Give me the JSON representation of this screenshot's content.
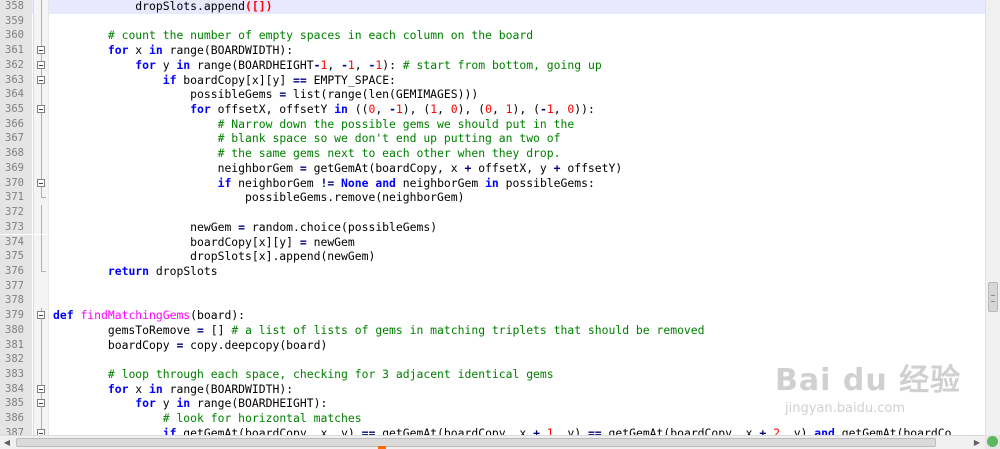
{
  "editor": {
    "lines": [
      {
        "n": "358",
        "fold": "line",
        "current": true,
        "html": "            dropSlots.append<span class=\"brk-hl\">([])</span>"
      },
      {
        "n": "359",
        "fold": "line",
        "html": ""
      },
      {
        "n": "360",
        "fold": "line",
        "html": "        <span class=\"cm\"># count the number of empty spaces in each column on the board</span>"
      },
      {
        "n": "361",
        "fold": "box",
        "html": "        <span class=\"kw\">for</span> x <span class=\"kw\">in</span> range(BOARDWIDTH):"
      },
      {
        "n": "362",
        "fold": "box",
        "html": "            <span class=\"kw\">for</span> y <span class=\"kw\">in</span> range(BOARDHEIGHT<span class=\"op\">-</span><span class=\"num\">1</span>, <span class=\"op\">-</span><span class=\"num\">1</span>, <span class=\"op\">-</span><span class=\"num\">1</span>): <span class=\"cm\"># start from bottom, going up</span>"
      },
      {
        "n": "363",
        "fold": "box",
        "html": "                <span class=\"kw\">if</span> boardCopy[x][y] <span class=\"op\">==</span> EMPTY_SPACE:"
      },
      {
        "n": "364",
        "fold": "line",
        "html": "                    possibleGems <span class=\"op\">=</span> list(range(len(GEMIMAGES)))"
      },
      {
        "n": "365",
        "fold": "box",
        "html": "                    <span class=\"kw\">for</span> offsetX, offsetY <span class=\"kw\">in</span> ((<span class=\"num\">0</span>, <span class=\"op\">-</span><span class=\"num\">1</span>), (<span class=\"num\">1</span>, <span class=\"num\">0</span>), (<span class=\"num\">0</span>, <span class=\"num\">1</span>), (<span class=\"op\">-</span><span class=\"num\">1</span>, <span class=\"num\">0</span>)):"
      },
      {
        "n": "366",
        "fold": "line",
        "html": "                        <span class=\"cm\"># Narrow down the possible gems we should put in the</span>"
      },
      {
        "n": "367",
        "fold": "line",
        "html": "                        <span class=\"cm\"># blank space so we don't end up putting an two of</span>"
      },
      {
        "n": "368",
        "fold": "line",
        "html": "                        <span class=\"cm\"># the same gems next to each other when they drop.</span>"
      },
      {
        "n": "369",
        "fold": "line",
        "html": "                        neighborGem <span class=\"op\">=</span> getGemAt(boardCopy, x <span class=\"op\">+</span> offsetX, y <span class=\"op\">+</span> offsetY)"
      },
      {
        "n": "370",
        "fold": "box",
        "html": "                        <span class=\"kw\">if</span> neighborGem <span class=\"op\">!=</span> <span class=\"kw\">None</span> <span class=\"kw\">and</span> neighborGem <span class=\"kw\">in</span> possibleGems:"
      },
      {
        "n": "371",
        "fold": "end",
        "html": "                            possibleGems.remove(neighborGem)"
      },
      {
        "n": "372",
        "fold": "line",
        "html": ""
      },
      {
        "n": "373",
        "fold": "line",
        "html": "                    newGem <span class=\"op\">=</span> random.choice(possibleGems)"
      },
      {
        "n": "374",
        "fold": "line",
        "html": "                    boardCopy[x][y] <span class=\"op\">=</span> newGem"
      },
      {
        "n": "375",
        "fold": "line",
        "html": "                    dropSlots[x].append(newGem)"
      },
      {
        "n": "376",
        "fold": "end",
        "html": "        <span class=\"kw\">return</span> dropSlots"
      },
      {
        "n": "377",
        "fold": "none",
        "html": ""
      },
      {
        "n": "378",
        "fold": "none",
        "html": ""
      },
      {
        "n": "379",
        "fold": "box",
        "html": "<span class=\"kw\">def</span> <span class=\"fn\">findMatchingGems</span>(board):"
      },
      {
        "n": "380",
        "fold": "line",
        "html": "        gemsToRemove <span class=\"op\">=</span> [] <span class=\"cm\"># a list of lists of gems in matching triplets that should be removed</span>"
      },
      {
        "n": "381",
        "fold": "line",
        "html": "        boardCopy <span class=\"op\">=</span> copy.deepcopy(board)"
      },
      {
        "n": "382",
        "fold": "line",
        "html": ""
      },
      {
        "n": "383",
        "fold": "line",
        "html": "        <span class=\"cm\"># loop through each space, checking for 3 adjacent identical gems</span>"
      },
      {
        "n": "384",
        "fold": "box",
        "html": "        <span class=\"kw\">for</span> x <span class=\"kw\">in</span> range(BOARDWIDTH):"
      },
      {
        "n": "385",
        "fold": "box",
        "html": "            <span class=\"kw\">for</span> y <span class=\"kw\">in</span> range(BOARDHEIGHT):"
      },
      {
        "n": "386",
        "fold": "line",
        "html": "                <span class=\"cm\"># look for horizontal matches</span>"
      },
      {
        "n": "387",
        "fold": "box",
        "html": "                <span class=\"kw\">if</span> getGemAt(boardCopy, x, y) <span class=\"op\">==</span> getGemAt(boardCopy, x <span class=\"op\">+</span> <span class=\"num\">1</span>, y) <span class=\"op\">==</span> getGemAt(boardCopy, x <span class=\"op\">+</span> <span class=\"num\">2</span>, y) <span class=\"kw\">and</span> getGemAt(boardCo"
      }
    ]
  },
  "watermark": {
    "logo": "Bai du 经验",
    "url": "jingyan.baidu.com"
  },
  "scrollbar": {
    "left_arrow": "◀",
    "right_arrow": "▶"
  },
  "colors": {
    "keyword": "#0000ff",
    "comment": "#008000",
    "number": "#ff0000",
    "function": "#ff00ff",
    "current_line": "#e8e8ff"
  }
}
